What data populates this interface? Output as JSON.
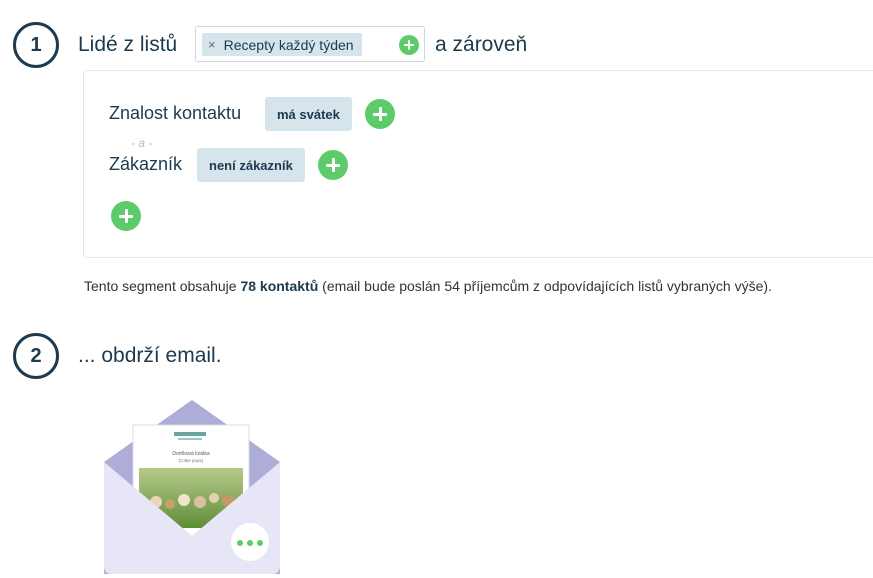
{
  "step1": {
    "number": "1",
    "prefix": "Lidé z listů",
    "chip_remove": "×",
    "chip_label": "Recepty každý týden",
    "suffix": "a zároveň"
  },
  "conditions": [
    {
      "label": "Znalost kontaktu",
      "value": "má svátek"
    },
    {
      "label": "Zákazník",
      "value": "není zákazník"
    }
  ],
  "and_separator": "- a -",
  "summary": {
    "before": "Tento segment obsahuje ",
    "count": "78 kontaktů",
    "after": " (email bude poslán 54 příjemcům z odpovídajících listů vybraných výše)."
  },
  "step2": {
    "number": "2",
    "title": "... obdrží email."
  },
  "email_preview": {
    "headline": "Dortíková lízátka",
    "subline": "(Cake pops)"
  },
  "colors": {
    "primary": "#1d3a4e",
    "accent_green": "#5ecb6a",
    "chip_bg": "#d6e4ec",
    "envelope": "#e6e6f6",
    "envelope_flap": "#aeadd8"
  }
}
